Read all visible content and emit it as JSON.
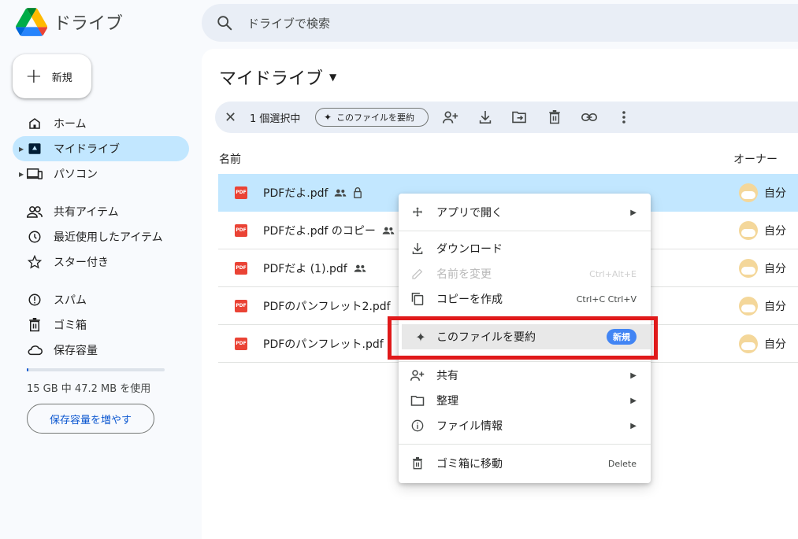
{
  "app": {
    "name": "ドライブ"
  },
  "search": {
    "placeholder": "ドライブで検索"
  },
  "sidebar": {
    "new_label": "新規",
    "items": [
      {
        "label": "ホーム",
        "icon": "home-icon"
      },
      {
        "label": "マイドライブ",
        "icon": "my-drive-icon",
        "active": true
      },
      {
        "label": "パソコン",
        "icon": "computer-icon"
      },
      {
        "label": "共有アイテム",
        "icon": "shared-icon"
      },
      {
        "label": "最近使用したアイテム",
        "icon": "clock-icon"
      },
      {
        "label": "スター付き",
        "icon": "star-icon"
      },
      {
        "label": "スパム",
        "icon": "spam-icon"
      },
      {
        "label": "ゴミ箱",
        "icon": "trash-icon"
      },
      {
        "label": "保存容量",
        "icon": "cloud-icon"
      }
    ],
    "storage_usage": 0.003,
    "storage_text": "15 GB 中 47.2 MB を使用",
    "storage_button": "保存容量を増やす"
  },
  "main": {
    "title": "マイドライブ",
    "selection": {
      "count_label": "1 個選択中",
      "summarize_chip": "このファイルを要約"
    },
    "columns": {
      "name": "名前",
      "owner": "オーナー"
    },
    "files": [
      {
        "name": "PDFだよ.pdf",
        "owner": "自分",
        "selected": true
      },
      {
        "name": "PDFだよ.pdf のコピー",
        "owner": "自分"
      },
      {
        "name": "PDFだよ (1).pdf",
        "owner": "自分"
      },
      {
        "name": "PDFのパンフレット2.pdf",
        "owner": "自分"
      },
      {
        "name": "PDFのパンフレット.pdf",
        "owner": "自分"
      }
    ],
    "pdf_icon_text": "PDF"
  },
  "context_menu": {
    "open_with": "アプリで開く",
    "download": "ダウンロード",
    "rename": "名前を変更",
    "rename_shortcut": "Ctrl+Alt+E",
    "copy": "コピーを作成",
    "copy_shortcut": "Ctrl+C Ctrl+V",
    "summarize": "このファイルを要約",
    "summarize_badge": "新規",
    "share": "共有",
    "organize": "整理",
    "file_info": "ファイル情報",
    "trash": "ゴミ箱に移動",
    "trash_shortcut": "Delete"
  },
  "colors": {
    "accent": "#0b57d0",
    "selected_row": "#c2e7ff",
    "highlight_box": "#e0191a",
    "pdf": "#ea4335",
    "badge": "#4285f4"
  }
}
